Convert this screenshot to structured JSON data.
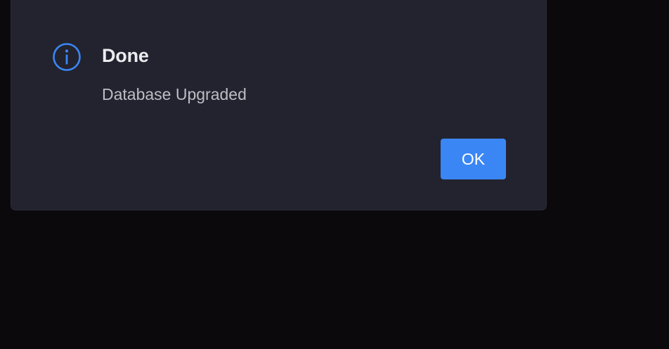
{
  "dialog": {
    "icon": "info-circle-icon",
    "title": "Done",
    "message": "Database Upgraded",
    "ok_label": "OK"
  },
  "colors": {
    "backdrop": "#0b090c",
    "dialog_background": "#22232e",
    "accent": "#3b86f5",
    "title_text": "#ececef",
    "message_text": "#bdbdc4"
  }
}
